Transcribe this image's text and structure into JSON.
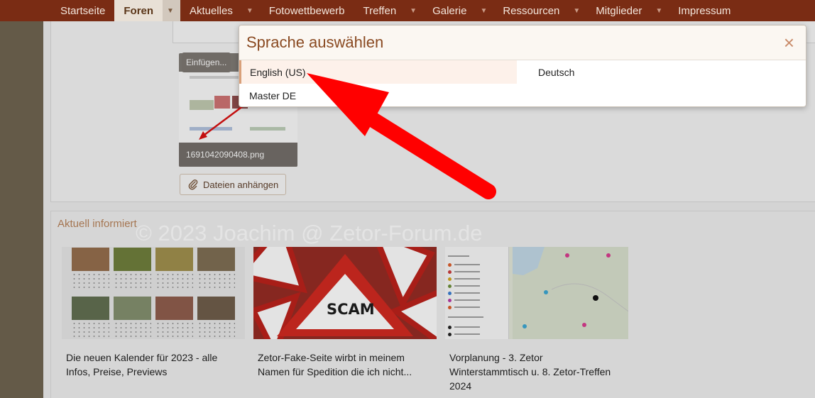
{
  "nav": {
    "items": [
      {
        "label": "Startseite",
        "active": false,
        "caret": false
      },
      {
        "label": "Foren",
        "active": true,
        "caret": true
      },
      {
        "label": "Aktuelles",
        "active": false,
        "caret": true
      },
      {
        "label": "Fotowettbewerb",
        "active": false,
        "caret": false
      },
      {
        "label": "Treffen",
        "active": false,
        "caret": true
      },
      {
        "label": "Galerie",
        "active": false,
        "caret": true
      },
      {
        "label": "Ressourcen",
        "active": false,
        "caret": true
      },
      {
        "label": "Mitglieder",
        "active": false,
        "caret": true
      },
      {
        "label": "Impressum",
        "active": false,
        "caret": false
      }
    ],
    "caret_glyph": "▼"
  },
  "editor": {
    "insert_label": "Einfügen...",
    "attachment_filename": "1691042090408.png",
    "attach_button_label": "Dateien anhängen"
  },
  "news": {
    "title": "Aktuell informiert",
    "cards": [
      {
        "text": "Die neuen Kalender für 2023 - alle Infos, Preise, Previews"
      },
      {
        "text": "Zetor-Fake-Seite wirbt in meinem Namen für Spedition die ich nicht...",
        "image_text": "SCAM"
      },
      {
        "text": "Vorplanung - 3. Zetor Winterstammtisch u. 8. Zetor-Treffen 2024"
      }
    ]
  },
  "watermark": "© 2023 Joachim @ Zetor-Forum.de",
  "dialog": {
    "title": "Sprache auswählen",
    "close_glyph": "×",
    "languages": [
      {
        "label": "English (US)",
        "selected": true
      },
      {
        "label": "Deutsch",
        "selected": false
      },
      {
        "label": "Master DE",
        "selected": false
      }
    ]
  },
  "colors": {
    "nav_bg": "#7a2c14",
    "accent": "#8a4a22",
    "arrow": "#ff0000"
  }
}
